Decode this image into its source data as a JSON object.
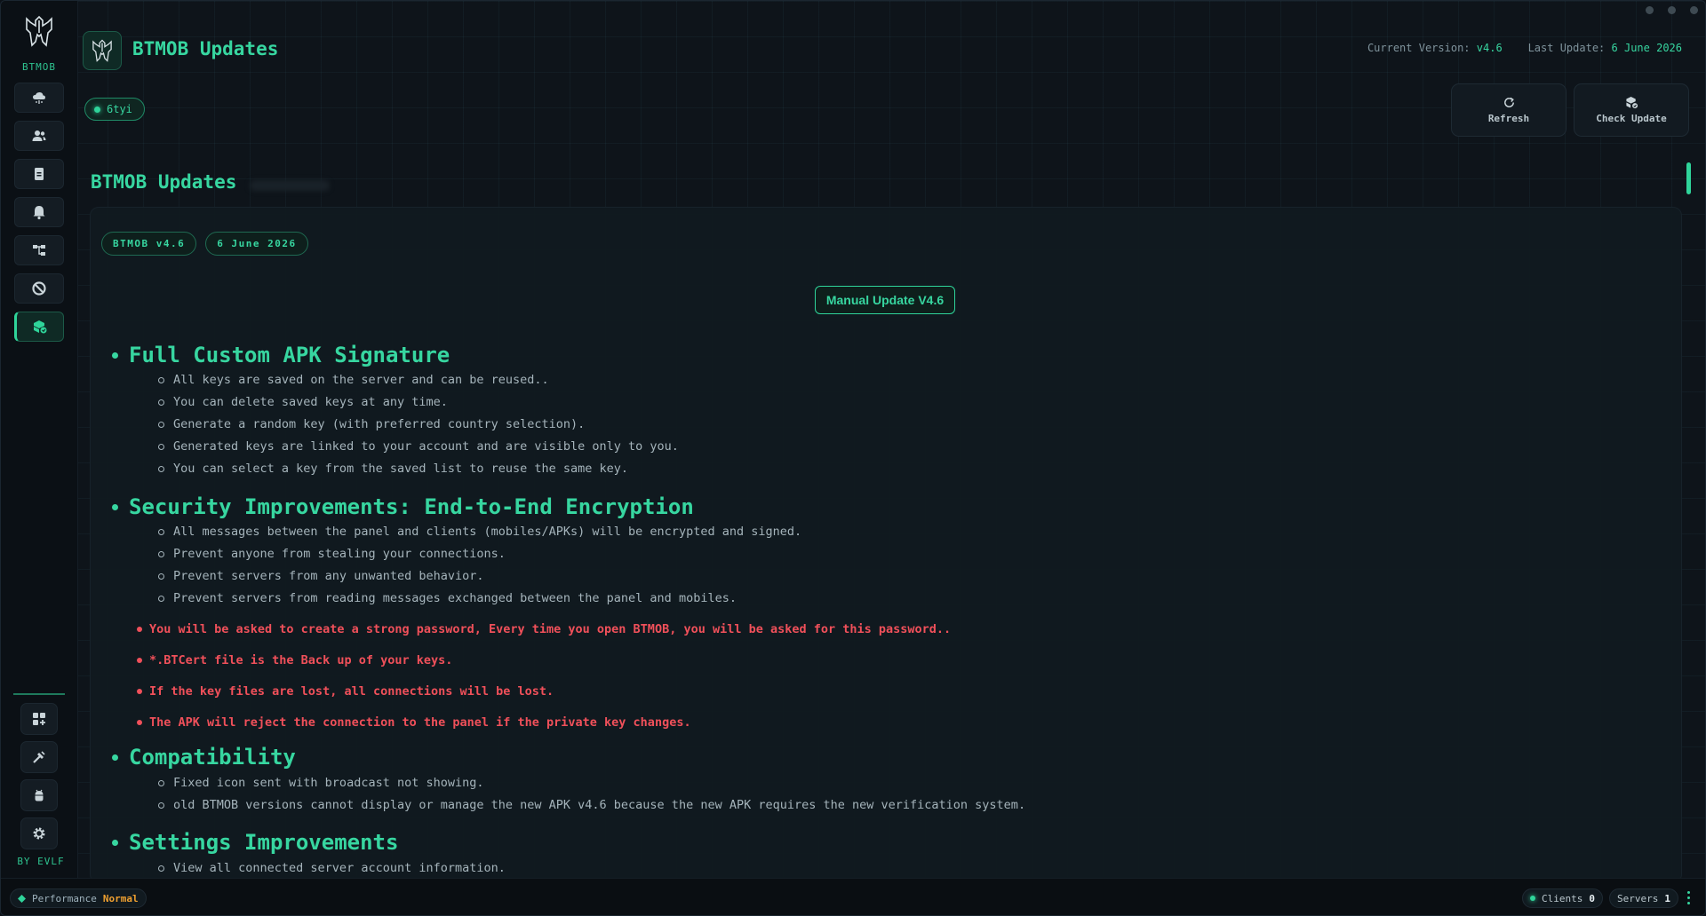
{
  "app": {
    "brand": "BTMOB",
    "byline": "BY EVLF",
    "title": "BTMOB Updates"
  },
  "header": {
    "version_label": "Current Version:",
    "version_value": "v4.6",
    "update_label": "Last Update:",
    "update_value": "6 June 2026",
    "user_chip": "6tyi",
    "refresh_label": "Refresh",
    "check_update_label": "Check Update"
  },
  "sidebar": {
    "items": [
      {
        "name": "cloud-icon"
      },
      {
        "name": "users-icon"
      },
      {
        "name": "file-icon"
      },
      {
        "name": "bell-icon"
      },
      {
        "name": "hierarchy-icon"
      },
      {
        "name": "block-icon"
      },
      {
        "name": "package-icon",
        "active": true
      }
    ],
    "bottom": [
      {
        "name": "apps-add-icon"
      },
      {
        "name": "tools-icon"
      },
      {
        "name": "android-icon"
      },
      {
        "name": "gear-icon"
      }
    ]
  },
  "content": {
    "section_title": "BTMOB Updates",
    "tag_version": "BTMOB v4.6",
    "tag_date": "6 June 2026",
    "manual_update": "Manual Update V4.6",
    "sections": [
      {
        "heading": "Full Custom APK Signature",
        "items": [
          "All keys are saved on the server and can be reused..",
          "You can delete saved keys at any time.",
          "Generate a random key (with preferred country selection).",
          "Generated keys are linked to your account and are visible only to you.",
          "You can select a key from the saved list to reuse the same key."
        ]
      },
      {
        "heading": "Security Improvements: End-to-End Encryption",
        "items": [
          "All messages between the panel and clients (mobiles/APKs) will be encrypted and signed.",
          "Prevent anyone from stealing your connections.",
          "Prevent servers from any unwanted behavior.",
          "Prevent servers from reading messages exchanged between the panel and mobiles."
        ],
        "warnings": [
          "You will be asked to create a strong password, Every time you open BTMOB, you will be asked for this password..",
          "*.BTCert file is the Back up of your keys.",
          "If the key files are lost, all connections will be lost.",
          "The APK will reject the connection to the panel if the private key changes."
        ]
      },
      {
        "heading": "Compatibility",
        "items": [
          "Fixed icon sent with broadcast not showing.",
          "old BTMOB versions cannot display or manage the new APK v4.6 because the new APK requires the new verification system."
        ]
      },
      {
        "heading": "Settings Improvements",
        "items": [
          "View all connected server account information."
        ]
      }
    ]
  },
  "status": {
    "performance_label": "Performance",
    "performance_value": "Normal",
    "clients_label": "Clients",
    "clients_value": "0",
    "servers_label": "Servers",
    "servers_value": "1"
  },
  "colors": {
    "accent": "#37d6a0",
    "warning": "#f0505a",
    "perf_normal": "#f0a030",
    "background": "#0c1117"
  }
}
